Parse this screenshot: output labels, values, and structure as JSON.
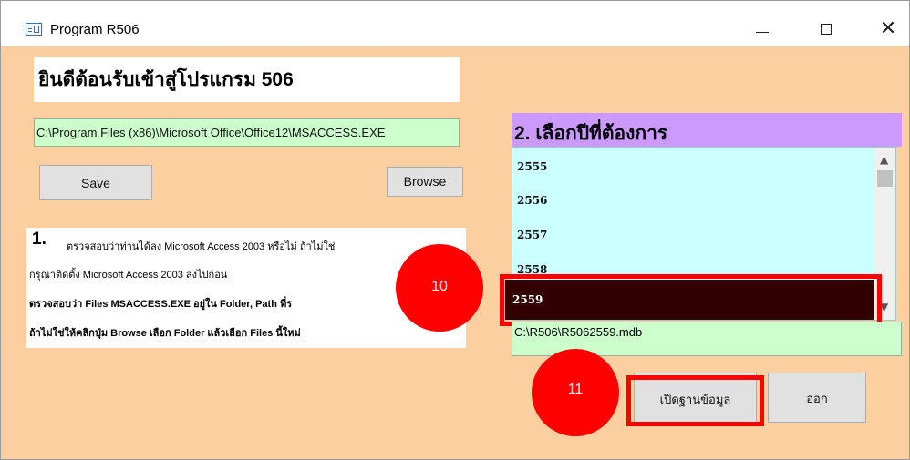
{
  "window": {
    "title": "Program R506",
    "minimize_label": "—",
    "maximize_label": "☐",
    "close_label": "✕"
  },
  "welcome": {
    "text": "ยินดีต้อนรับเข้าสู่โปรแกรม 506"
  },
  "access_path": {
    "value": "C:\\Program Files (x86)\\Microsoft Office\\Office12\\MSACCESS.EXE"
  },
  "buttons": {
    "save": "Save",
    "browse": "Browse",
    "open_db": "เปิดฐานข้อมูล",
    "exit": "ออก"
  },
  "instructions": {
    "step_number": "1.",
    "line1": "ตรวจสอบว่าท่านได้ลง Microsoft Access 2003 หรือไม่ ถ้าไม่ใช่",
    "line2": "กรุณาติดตั้ง Microsoft Access 2003 ลงไปก่อน",
    "line3": "ตรวจสอบว่า Files  MSACCESS.EXE อยู่ใน Folder, Path ที่ร",
    "line4": "ถ้าไม่ใช่ให้คลิกปุ่ม  Browse เลือก Folder แล้วเลือก Files นี้ใหม่"
  },
  "year_select": {
    "header": "2. เลือกปีที่ต้องการ",
    "years": [
      "2555",
      "2556",
      "2557",
      "2558",
      "2559"
    ],
    "selected": "2559"
  },
  "database_path": {
    "value": "C:\\R506\\R5062559.mdb"
  },
  "markers": {
    "m10": "10",
    "m11": "11"
  },
  "colors": {
    "background": "#fbcf9f",
    "selected": "#330000",
    "highlight": "#ff0000",
    "list_bg": "#ccffff",
    "header_bg": "#cc99ff",
    "path_bg": "#ccffcc"
  }
}
